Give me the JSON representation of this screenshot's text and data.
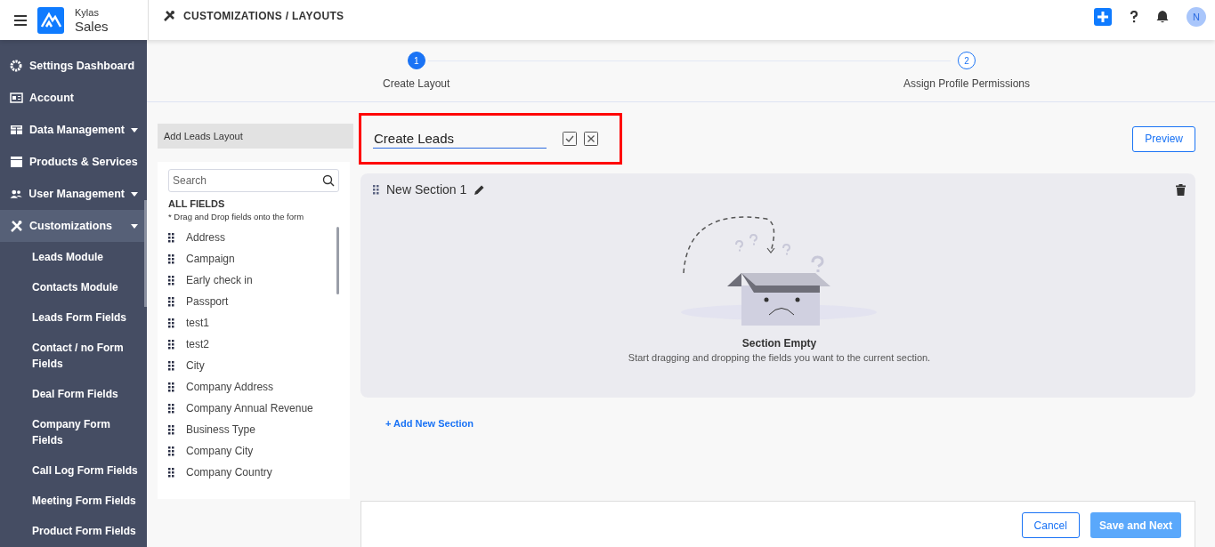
{
  "header": {
    "logo_top": "Kylas",
    "logo_bottom": "Sales",
    "breadcrumb": "CUSTOMIZATIONS / LAYOUTS",
    "avatar": "N"
  },
  "sidebar": {
    "items": [
      {
        "label": "Settings Dashboard",
        "kind": "link",
        "selected": false
      },
      {
        "label": "Account",
        "kind": "link",
        "selected": false
      },
      {
        "label": "Data Management",
        "kind": "dropdown",
        "selected": false
      },
      {
        "label": "Products & Services",
        "kind": "link",
        "selected": false
      },
      {
        "label": "User Management",
        "kind": "dropdown",
        "selected": false
      },
      {
        "label": "Customizations",
        "kind": "dropdown",
        "selected": true,
        "children": [
          {
            "label": "Leads Module"
          },
          {
            "label": "Contacts Module"
          },
          {
            "label": "Leads Form Fields"
          },
          {
            "label": "Contact / no Form Fields"
          },
          {
            "label": "Deal Form Fields"
          },
          {
            "label": "Company Form Fields"
          },
          {
            "label": "Call Log Form Fields"
          },
          {
            "label": "Meeting Form Fields"
          },
          {
            "label": "Product Form Fields"
          }
        ]
      }
    ]
  },
  "steps": [
    {
      "number": "1",
      "label": "Create Layout",
      "selected": true
    },
    {
      "number": "2",
      "label": "Assign Profile Permissions",
      "selected": false
    }
  ],
  "fields_panel": {
    "title": "Add Leads Layout",
    "search": {
      "placeholder": "Search"
    },
    "heading": "ALL FIELDS",
    "hint": "* Drag and Drop fields onto the form",
    "fields": [
      "Address",
      "Campaign",
      "Early check in",
      "Passport",
      "test1",
      "test2",
      "City",
      "Company Address",
      "Company Annual Revenue",
      "Business Type",
      "Company City",
      "Company Country"
    ]
  },
  "layout_title": {
    "value": "Create Leads",
    "highlighted": true
  },
  "preview_button": "Preview",
  "section": {
    "title": "New Section 1",
    "empty_title": "Section Empty",
    "empty_text": "Start dragging and dropping the fields you want to the current section."
  },
  "add_section": "+ Add New Section",
  "footer": {
    "cancel": "Cancel",
    "save": "Save and Next"
  }
}
